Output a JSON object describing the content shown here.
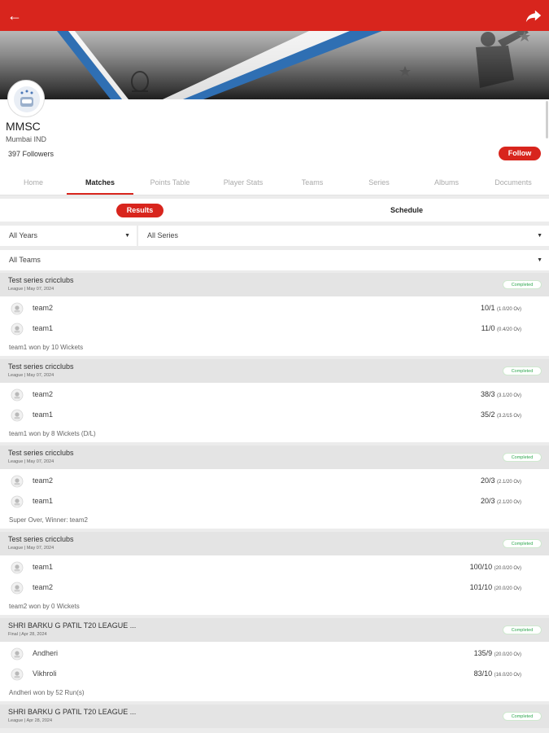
{
  "header": {
    "back_icon": "arrow-left-icon",
    "share_icon": "share-icon",
    "accent": "#d8251d"
  },
  "club": {
    "name": "MMSC",
    "location": "Mumbai IND",
    "followers": "397 Followers",
    "follow_label": "Follow"
  },
  "tabs": [
    "Home",
    "Matches",
    "Points Table",
    "Player Stats",
    "Teams",
    "Series",
    "Albums",
    "Documents"
  ],
  "active_tab": "Matches",
  "segment": {
    "results": "Results",
    "schedule": "Schedule"
  },
  "filters": {
    "years": "All Years",
    "series": "All Series",
    "teams": "All Teams"
  },
  "matches": [
    {
      "series": "Test series cricclubs",
      "meta": "League | May 07, 2024",
      "status": "Completed",
      "teams": [
        {
          "name": "team2",
          "score": "10/1",
          "overs": "(1.0/20 Ov)"
        },
        {
          "name": "team1",
          "score": "11/0",
          "overs": "(0.4/20 Ov)"
        }
      ],
      "result": "team1 won by 10 Wickets"
    },
    {
      "series": "Test series cricclubs",
      "meta": "League | May 07, 2024",
      "status": "Completed",
      "teams": [
        {
          "name": "team2",
          "score": "38/3",
          "overs": "(3.1/20 Ov)"
        },
        {
          "name": "team1",
          "score": "35/2",
          "overs": "(3.2/15 Ov)"
        }
      ],
      "result": "team1 won by 8 Wickets (D/L)"
    },
    {
      "series": "Test series cricclubs",
      "meta": "League | May 07, 2024",
      "status": "Completed",
      "teams": [
        {
          "name": "team2",
          "score": "20/3",
          "overs": "(2.1/20 Ov)"
        },
        {
          "name": "team1",
          "score": "20/3",
          "overs": "(2.1/20 Ov)"
        }
      ],
      "result": "Super Over, Winner: team2"
    },
    {
      "series": "Test series cricclubs",
      "meta": "League | May 07, 2024",
      "status": "Completed",
      "teams": [
        {
          "name": "team1",
          "score": "100/10",
          "overs": "(20.0/20 Ov)"
        },
        {
          "name": "team2",
          "score": "101/10",
          "overs": "(20.0/20 Ov)"
        }
      ],
      "result": "team2 won by 0 Wickets"
    },
    {
      "series": "SHRI BARKU G PATIL T20 LEAGUE ...",
      "meta": "Final | Apr 28, 2024",
      "status": "Completed",
      "teams": [
        {
          "name": "Andheri",
          "score": "135/9",
          "overs": "(20.0/20 Ov)"
        },
        {
          "name": "Vikhroli",
          "score": "83/10",
          "overs": "(16.0/20 Ov)"
        }
      ],
      "result": "Andheri won by 52 Run(s)"
    },
    {
      "series": "SHRI BARKU G PATIL T20 LEAGUE ...",
      "meta": "League | Apr 28, 2024",
      "status": "Completed",
      "teams": [],
      "result": ""
    }
  ]
}
